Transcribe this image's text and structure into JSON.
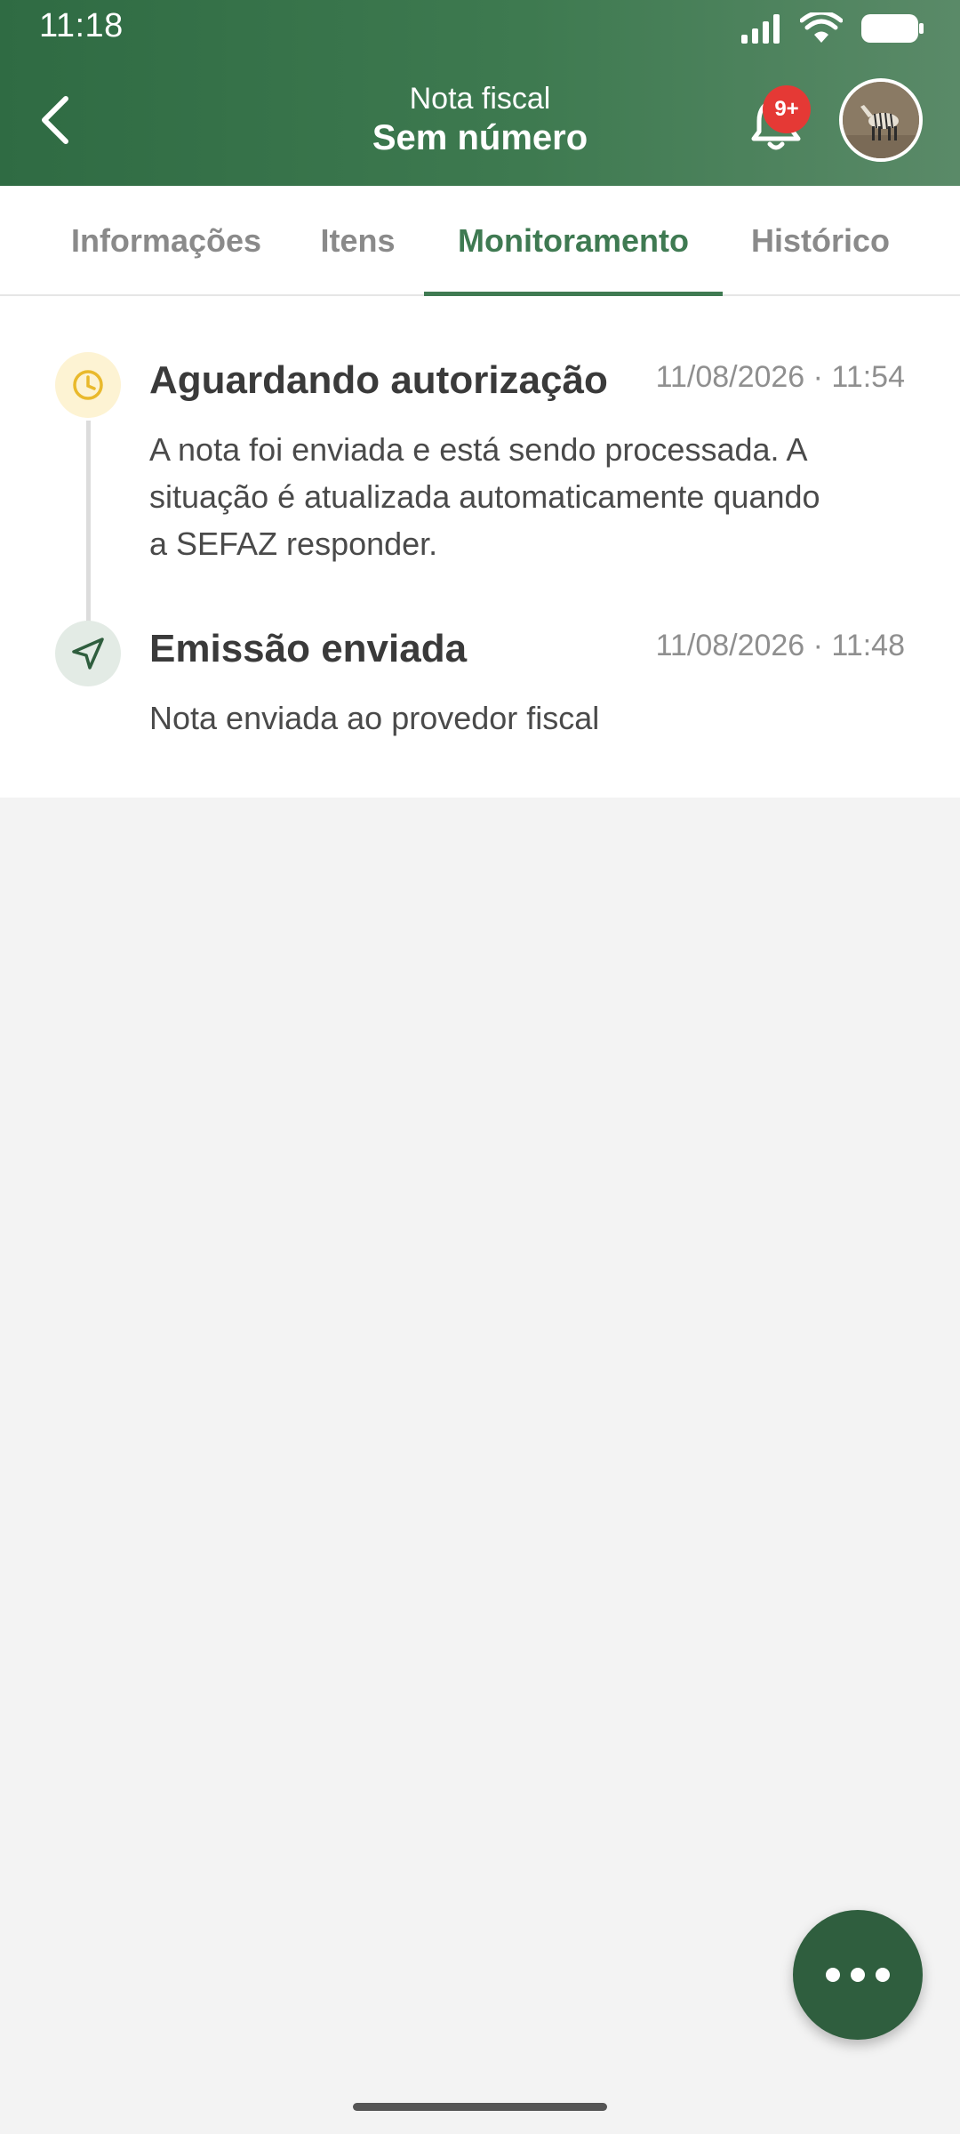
{
  "status_bar": {
    "time": "11:18"
  },
  "header": {
    "title_small": "Nota fiscal",
    "title_big": "Sem número",
    "notification_badge": "9+",
    "accent_color": "#3f7a52"
  },
  "tabs": [
    {
      "label": "Informações",
      "active": false
    },
    {
      "label": "Itens",
      "active": false
    },
    {
      "label": "Monitoramento",
      "active": true
    },
    {
      "label": "Histórico",
      "active": false
    }
  ],
  "timeline": [
    {
      "icon": "clock-icon",
      "title": "Aguardando autorização",
      "date": "11/08/2026 · 11:54",
      "description_lines": [
        "A nota foi enviada e está sendo processada. A",
        "situação é atualizada automaticamente quando",
        "a SEFAZ responder."
      ],
      "status_color": "#f1c232"
    },
    {
      "icon": "send-icon",
      "title": "Emissão enviada",
      "date": "11/08/2026 · 11:48",
      "description_lines": [
        "Nota enviada ao provedor fiscal"
      ],
      "status_color": "#2f5e3e"
    }
  ],
  "fab": {
    "icon": "more-horizontal-icon"
  }
}
